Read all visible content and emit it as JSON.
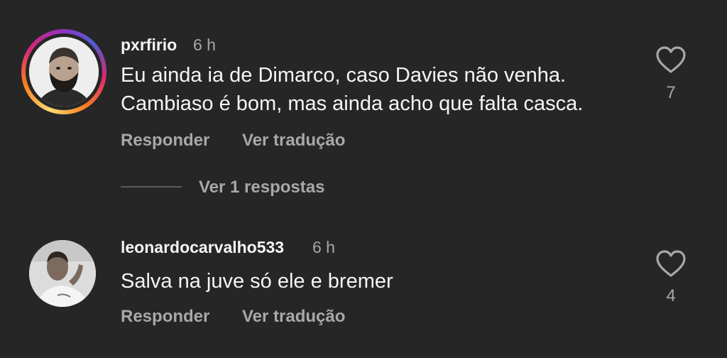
{
  "comments": [
    {
      "username": "pxrfirio",
      "time": "6 h",
      "text_line1": "Eu ainda ia de Dimarco, caso Davies não venha.",
      "text_line2": "Cambiaso é bom, mas ainda acho que falta casca.",
      "reply_label": "Responder",
      "translate_label": "Ver tradução",
      "likes": "7",
      "view_replies_label": "Ver 1 respostas"
    },
    {
      "username": "leonardocarvalho533",
      "time": "6 h",
      "text_line1": "Salva na juve só ele e bremer",
      "reply_label": "Responder",
      "translate_label": "Ver tradução",
      "likes": "4"
    }
  ],
  "icons": {
    "like": "heart-outline-icon"
  },
  "colors": {
    "background": "#262626",
    "primary_text": "#f5f5f5",
    "secondary_text": "#a8a8a8"
  }
}
